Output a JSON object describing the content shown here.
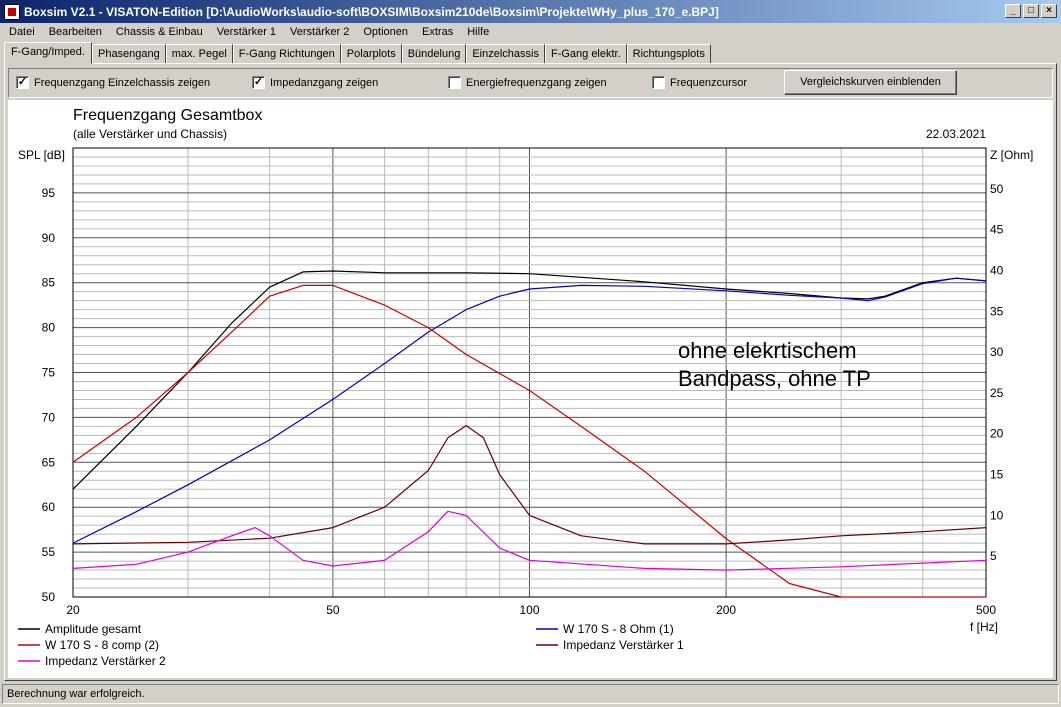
{
  "window": {
    "title": "Boxsim V2.1 - VISATON-Edition [D:\\AudioWorks\\audio-soft\\BOXSIM\\Boxsim210de\\Boxsim\\Projekte\\WHy_plus_170_e.BPJ]",
    "minimize": "_",
    "maximize": "□",
    "close": "×"
  },
  "menu": [
    "Datei",
    "Bearbeiten",
    "Chassis & Einbau",
    "Verstärker 1",
    "Verstärker 2",
    "Optionen",
    "Extras",
    "Hilfe"
  ],
  "tabs": [
    "F-Gang/Imped.",
    "Phasengang",
    "max. Pegel",
    "F-Gang Richtungen",
    "Polarplots",
    "Bündelung",
    "Einzelchassis",
    "F-Gang elektr.",
    "Richtungsplots"
  ],
  "active_tab": 0,
  "options": {
    "cb1": {
      "label": "Frequenzgang Einzelchassis zeigen",
      "checked": "✓"
    },
    "cb2": {
      "label": "Impedanzgang zeigen",
      "checked": "✓"
    },
    "cb3": {
      "label": "Energiefrequenzgang zeigen",
      "checked": ""
    },
    "cb4": {
      "label": "Frequenzcursor",
      "checked": ""
    },
    "compare_button": "Vergleichskurven einblenden"
  },
  "status": "Berechnung war erfolgreich.",
  "chart_data": {
    "type": "line",
    "title": "Frequenzgang Gesamtbox",
    "subtitle": "(alle Verstärker und Chassis)",
    "date": "22.03.2021",
    "annotation": [
      "ohne elekrtischem",
      "Bandpass, ohne TP"
    ],
    "xlabel": "f [Hz]",
    "ylabel_left": "SPL [dB]",
    "ylabel_right": "Z [Ohm]",
    "x_scale": "log",
    "xlim": [
      20,
      500
    ],
    "ylim_left": [
      50,
      100
    ],
    "ylim_right": [
      0,
      55
    ],
    "x_ticks": [
      20,
      50,
      100,
      200,
      500
    ],
    "y_ticks_left": [
      50,
      55,
      60,
      65,
      70,
      75,
      80,
      85,
      90,
      95
    ],
    "y_ticks_right": [
      5,
      10,
      15,
      20,
      25,
      30,
      35,
      40,
      45,
      50
    ],
    "grid": true,
    "legend_position": "bottom",
    "series": [
      {
        "name": "Amplitude gesamt",
        "color": "#000000",
        "axis": "left",
        "x": [
          20,
          25,
          30,
          35,
          40,
          45,
          50,
          60,
          70,
          80,
          100,
          120,
          150,
          200,
          250,
          300,
          330,
          350,
          400,
          450,
          500
        ],
        "y": [
          62,
          69,
          75,
          80.5,
          84.5,
          86.2,
          86.3,
          86.1,
          86.1,
          86.1,
          86.0,
          85.6,
          85.1,
          84.3,
          83.8,
          83.3,
          83.2,
          83.5,
          85.0,
          85.5,
          85.2
        ]
      },
      {
        "name": "W 170 S - 8 Ohm (1)",
        "color": "#0000cc",
        "axis": "left",
        "x": [
          20,
          25,
          30,
          40,
          50,
          60,
          70,
          80,
          90,
          100,
          120,
          150,
          200,
          250,
          300,
          330,
          350,
          400,
          450,
          500
        ],
        "y": [
          56,
          59.5,
          62.5,
          67.5,
          72,
          76,
          79.5,
          82,
          83.5,
          84.3,
          84.7,
          84.6,
          84.1,
          83.6,
          83.3,
          83.0,
          83.4,
          84.9,
          85.5,
          85.2
        ]
      },
      {
        "name": "W 170 S - 8 comp (2)",
        "color": "#cc0000",
        "axis": "left",
        "x": [
          20,
          25,
          30,
          35,
          40,
          45,
          50,
          60,
          70,
          80,
          100,
          120,
          150,
          200,
          250,
          300,
          500
        ],
        "y": [
          65,
          70,
          75,
          79.5,
          83.5,
          84.7,
          84.7,
          82.5,
          80,
          77,
          73,
          69,
          64,
          56.5,
          51.5,
          50,
          50
        ]
      },
      {
        "name": "Impedanz Verstärker 1",
        "color": "#660000",
        "axis": "right",
        "x": [
          20,
          30,
          40,
          50,
          60,
          70,
          75,
          80,
          85,
          90,
          100,
          120,
          150,
          200,
          250,
          300,
          400,
          500
        ],
        "y": [
          6.5,
          6.7,
          7.2,
          8.5,
          11,
          15.5,
          19.5,
          21,
          19.5,
          15,
          10,
          7.5,
          6.5,
          6.5,
          7,
          7.5,
          8,
          8.5
        ]
      },
      {
        "name": "Impedanz Verstärker 2",
        "color": "#dd00dd",
        "axis": "right",
        "x": [
          20,
          25,
          30,
          35,
          38,
          40,
          45,
          50,
          60,
          70,
          75,
          80,
          90,
          100,
          150,
          200,
          300,
          500
        ],
        "y": [
          3.5,
          4,
          5.5,
          7.5,
          8.5,
          7.5,
          4.5,
          3.8,
          4.5,
          8,
          10.5,
          10,
          6,
          4.5,
          3.5,
          3.3,
          3.7,
          4.5
        ]
      }
    ]
  }
}
